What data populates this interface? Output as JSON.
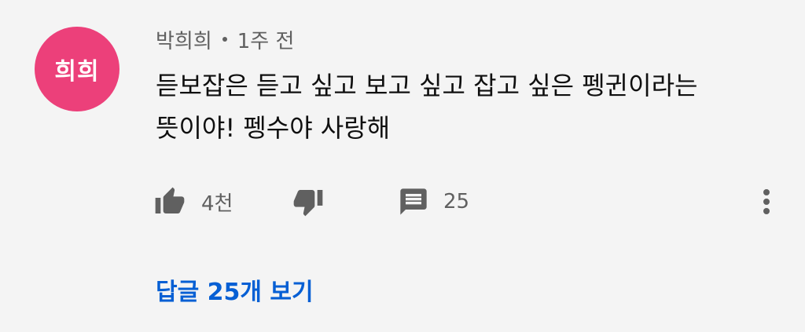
{
  "comment": {
    "avatar_text": "희희",
    "avatar_color": "#ec407a",
    "author": "박희희",
    "time": "1주 전",
    "text_lines": [
      "듣보잡은 듣고 싶고 보고 싶고 잡고 싶은 펭귄이라는",
      "뜻이야! 펭수야 사랑해"
    ],
    "likes": "4천",
    "reply_count": "25",
    "view_replies_label": "답글 25개 보기"
  },
  "icons": {
    "like": "thumbs-up-icon",
    "dislike": "thumbs-down-icon",
    "reply": "comment-icon",
    "more": "more-vertical-icon"
  },
  "colors": {
    "background": "#f4f4f4",
    "link": "#065fd4",
    "secondary_text": "#606060"
  }
}
